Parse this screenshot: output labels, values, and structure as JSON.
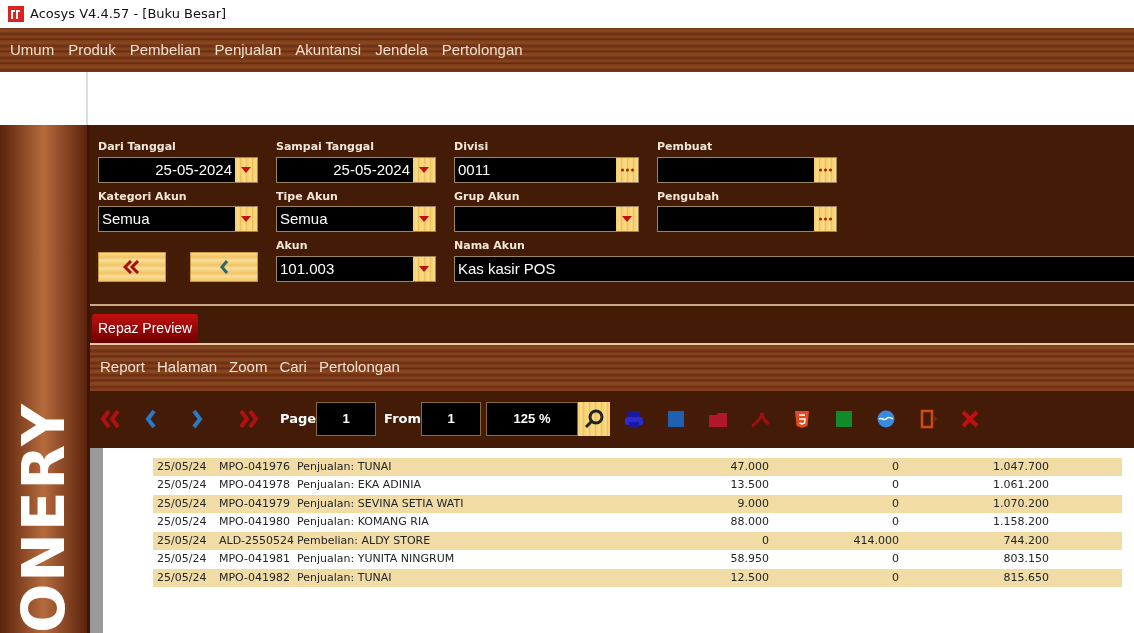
{
  "window": {
    "title": "Acosys V4.4.57 - [Buku Besar]"
  },
  "menu": [
    "Umum",
    "Produk",
    "Pembelian",
    "Penjualan",
    "Akuntansi",
    "Jendela",
    "Pertolongan"
  ],
  "sidebar_text": "ONERY",
  "filters": [
    {
      "label": "Dari Tanggal",
      "value": "25-05-2024",
      "kind": "date"
    },
    {
      "label": "Sampai Tanggal",
      "value": "25-05-2024",
      "kind": "date"
    },
    {
      "label": "Divisi",
      "value": "0011",
      "kind": "lookup"
    },
    {
      "label": "Pembuat",
      "kind": "lookup"
    },
    {
      "label": "Kategori Akun",
      "value": "Semua",
      "kind": "dropdown"
    },
    {
      "label": "Tipe Akun",
      "value": "Semua",
      "kind": "dropdown"
    },
    {
      "label": "Grup Akun",
      "kind": "dropdown"
    },
    {
      "label": "Pengubah",
      "kind": "lookup"
    },
    {
      "label": "Akun",
      "value": "101.003",
      "kind": "dropdown"
    },
    {
      "label": "Nama Akun",
      "value": "Kas kasir POS",
      "kind": "text"
    }
  ],
  "tabs": [
    {
      "label": "Repaz Preview",
      "selected": true
    }
  ],
  "preview_menu": [
    "Report",
    "Halaman",
    "Zoom",
    "Cari",
    "Pertolongan"
  ],
  "toolbar": {
    "page_label": "Page",
    "page": "1",
    "from_label": "From",
    "from": "1",
    "zoom": "125 %"
  },
  "rows": [
    {
      "date": "25/05/24",
      "number": "MPO-041976",
      "description": "Penjualan: TUNAI",
      "debit": "47.000",
      "credit": "0",
      "balance": "1.047.700"
    },
    {
      "date": "25/05/24",
      "number": "MPO-041978",
      "description": "Penjualan: EKA ADINIA",
      "debit": "13.500",
      "credit": "0",
      "balance": "1.061.200"
    },
    {
      "date": "25/05/24",
      "number": "MPO-041979",
      "description": "Penjualan: SEVINA SETIA WATI",
      "debit": "9.000",
      "credit": "0",
      "balance": "1.070.200"
    },
    {
      "date": "25/05/24",
      "number": "MPO-041980",
      "description": "Penjualan: KOMANG RIA",
      "debit": "88.000",
      "credit": "0",
      "balance": "1.158.200"
    },
    {
      "date": "25/05/24",
      "number": "ALD-2550524",
      "description": "Pembelian: ALDY STORE",
      "debit": "0",
      "credit": "414.000",
      "balance": "744.200"
    },
    {
      "date": "25/05/24",
      "number": "MPO-041981",
      "description": "Penjualan: YUNITA NINGRUM",
      "debit": "58.950",
      "credit": "0",
      "balance": "803.150"
    },
    {
      "date": "25/05/24",
      "number": "MPO-041982",
      "description": "Penjualan: TUNAI",
      "debit": "12.500",
      "credit": "0",
      "balance": "815.650"
    }
  ]
}
